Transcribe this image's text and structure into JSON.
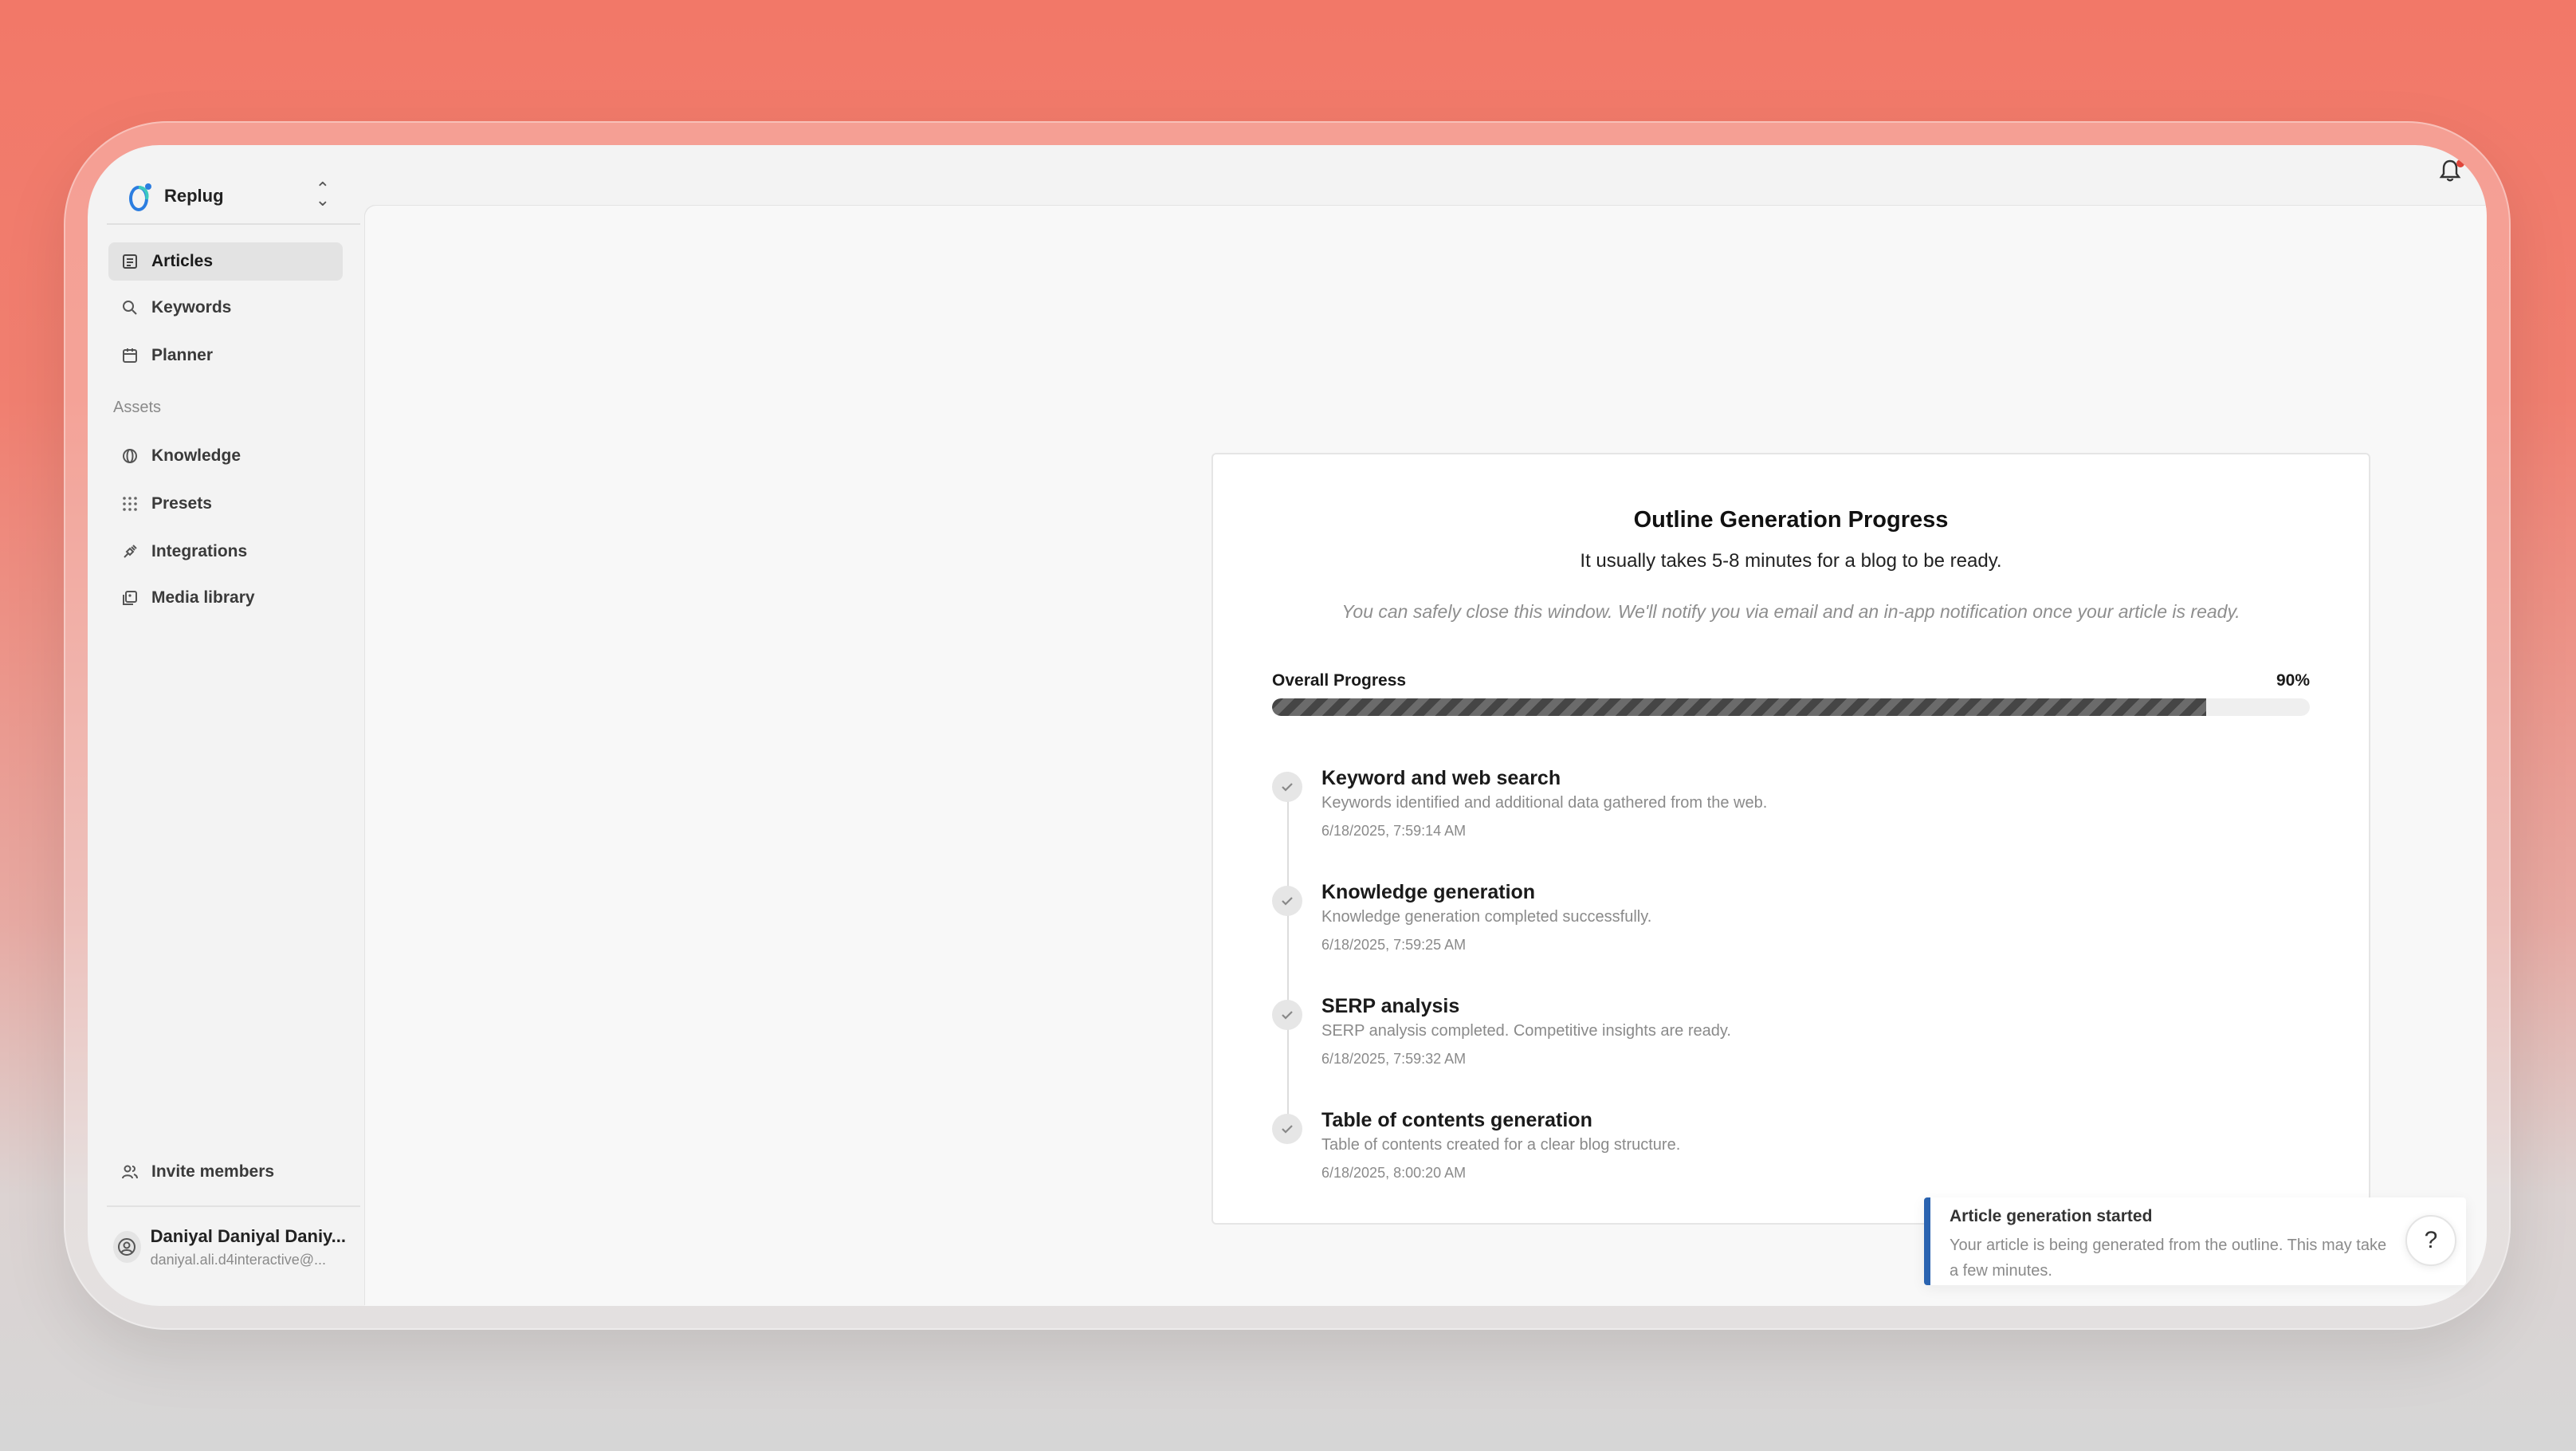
{
  "workspace": {
    "name": "Replug"
  },
  "sidebar": {
    "items": [
      {
        "label": "Articles",
        "icon": "article-icon",
        "active": true
      },
      {
        "label": "Keywords",
        "icon": "search-icon"
      },
      {
        "label": "Planner",
        "icon": "calendar-icon"
      }
    ],
    "assets_label": "Assets",
    "asset_items": [
      {
        "label": "Knowledge",
        "icon": "globe-icon"
      },
      {
        "label": "Presets",
        "icon": "grid-icon"
      },
      {
        "label": "Integrations",
        "icon": "plug-icon"
      },
      {
        "label": "Media library",
        "icon": "media-icon"
      }
    ],
    "invite_label": "Invite members",
    "user": {
      "name": "Daniyal Daniyal Daniy...",
      "email": "daniyal.ali.d4interactive@..."
    }
  },
  "card": {
    "title": "Outline Generation Progress",
    "subtitle": "It usually takes 5-8 minutes for a blog to be ready.",
    "note": "You can safely close this window. We'll notify you via email and an in-app notification once your article is ready.",
    "progress_label": "Overall Progress",
    "progress_percent_text": "90%",
    "progress_value": 90,
    "steps": [
      {
        "title": "Keyword and web search",
        "description": "Keywords identified and additional data gathered from the web.",
        "timestamp": "6/18/2025, 7:59:14 AM"
      },
      {
        "title": "Knowledge generation",
        "description": "Knowledge generation completed successfully.",
        "timestamp": "6/18/2025, 7:59:25 AM"
      },
      {
        "title": "SERP analysis",
        "description": "SERP analysis completed. Competitive insights are ready.",
        "timestamp": "6/18/2025, 7:59:32 AM"
      },
      {
        "title": "Table of contents generation",
        "description": "Table of contents created for a clear blog structure.",
        "timestamp": "6/18/2025, 8:00:20 AM"
      }
    ]
  },
  "toast": {
    "title": "Article generation started",
    "body": "Your article is being generated from the outline. This may take a few minutes."
  },
  "help": {
    "label": "?"
  },
  "colors": {
    "accent": "#2a63b0",
    "notification_dot": "#e0453a",
    "progress_fill": "#454545"
  }
}
